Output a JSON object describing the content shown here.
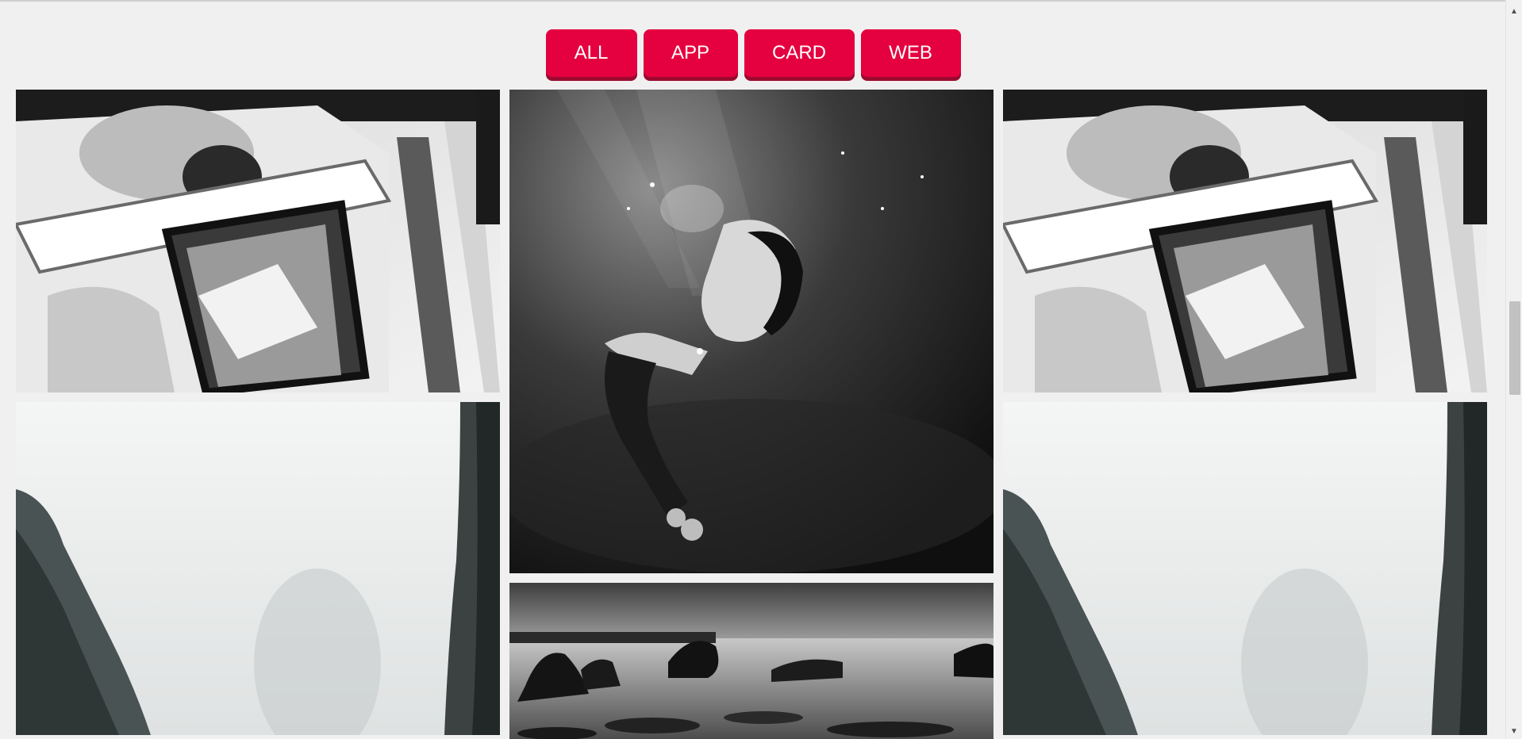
{
  "filters": [
    {
      "label": "ALL"
    },
    {
      "label": "APP"
    },
    {
      "label": "CARD"
    },
    {
      "label": "WEB"
    }
  ],
  "colors": {
    "accent": "#e5003f",
    "accent_shadow": "#9c0a2f",
    "background": "#f0f0f0"
  },
  "gallery": {
    "images": [
      {
        "subject": "couple-in-car-window",
        "style": "black-and-white"
      },
      {
        "subject": "foggy-cliffs",
        "style": "black-and-white"
      },
      {
        "subject": "underwater-woman",
        "style": "black-and-white"
      },
      {
        "subject": "rocky-seashore",
        "style": "black-and-white"
      },
      {
        "subject": "couple-in-car-window",
        "style": "black-and-white"
      },
      {
        "subject": "foggy-cliffs",
        "style": "black-and-white"
      }
    ]
  },
  "scrollbar": {
    "up_icon": "triangle-up-icon",
    "down_icon": "triangle-down-icon"
  }
}
